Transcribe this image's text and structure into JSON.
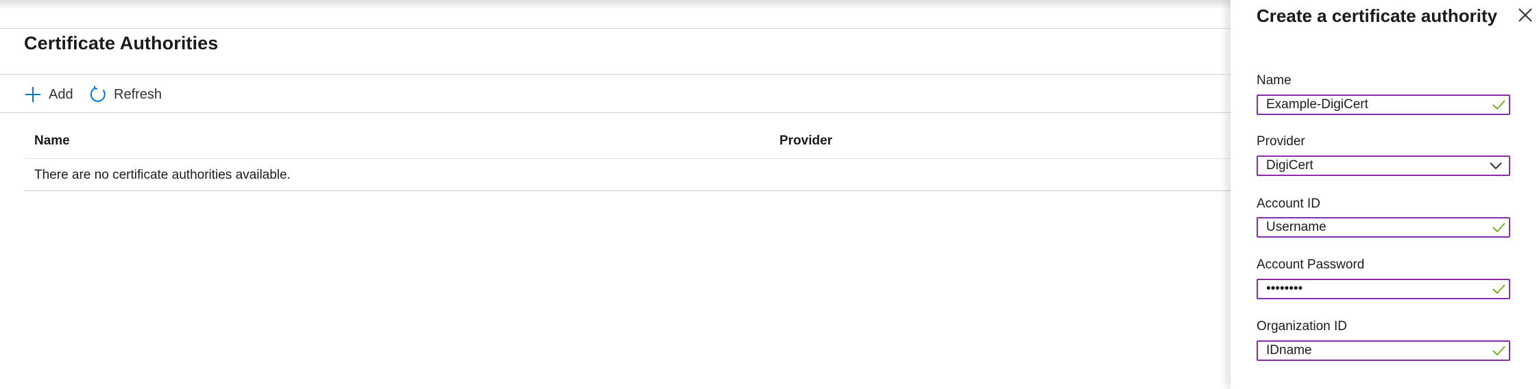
{
  "page": {
    "title": "Certificate Authorities"
  },
  "toolbar": {
    "add_label": "Add",
    "refresh_label": "Refresh"
  },
  "table": {
    "columns": [
      "Name",
      "Provider"
    ],
    "empty_message": "There are no certificate authorities available."
  },
  "panel": {
    "title": "Create a certificate authority",
    "fields": [
      {
        "label": "Name",
        "value": "Example-DigiCert",
        "status": "valid"
      },
      {
        "label": "Provider",
        "value": "DigiCert",
        "type": "dropdown"
      },
      {
        "label": "Account ID",
        "value": "Username",
        "status": "valid"
      },
      {
        "label": "Account Password",
        "value": "••••••••",
        "status": "valid"
      },
      {
        "label": "Organization ID",
        "value": "IDname",
        "status": "valid"
      }
    ]
  },
  "colors": {
    "accent": "#0078d4",
    "field_border": "#8a2da5",
    "valid_check": "#57a300"
  },
  "icons": {
    "add": "plus-icon",
    "refresh": "refresh-icon",
    "close": "close-icon",
    "dropdown": "chevron-down-icon",
    "valid": "checkmark-icon"
  }
}
